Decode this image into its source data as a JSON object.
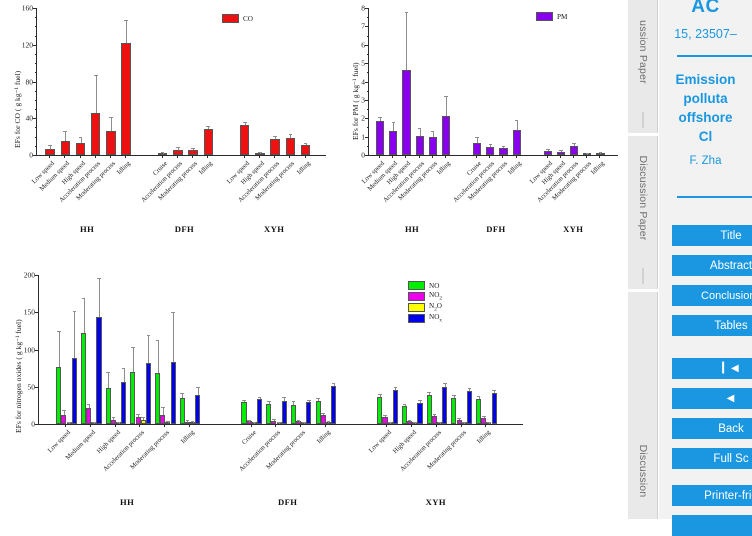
{
  "figure": {
    "charts": [
      {
        "id": "co",
        "title": "",
        "ylabel": "EFs for CO ( g kg⁻¹ fuel)",
        "legend": [
          {
            "name": "CO",
            "color": "#ee1111"
          }
        ],
        "ylim": [
          0,
          160
        ],
        "yticks": [
          0,
          40,
          80,
          120,
          160
        ],
        "groups": [
          {
            "name": "HH",
            "categories": [
              "Low speed",
              "Medium speed",
              "High speed",
              "Acceleration process",
              "Moderating process",
              "Idling"
            ],
            "values": [
              6.5,
              15.5,
              13.0,
              45.5,
              26.5,
              122.0
            ],
            "errors": [
              3.0,
              9.5,
              5.0,
              40.0,
              13.5,
              24.0
            ]
          },
          {
            "name": "DFH",
            "categories": [
              "Cruise",
              "Acceleration process",
              "Moderating process",
              "Idling"
            ],
            "values": [
              1.8,
              6.0,
              5.5,
              28.5
            ],
            "errors": [
              0.8,
              1.5,
              1.5,
              2.2
            ]
          },
          {
            "name": "XYH",
            "categories": [
              "Low speed",
              "High speed",
              "Acceleration process",
              "Moderating process",
              "Idling"
            ],
            "values": [
              32.5,
              1.3,
              17.5,
              19.0,
              10.5
            ],
            "errors": [
              2.5,
              0.6,
              1.8,
              2.5,
              2.0
            ]
          }
        ]
      },
      {
        "id": "pm",
        "title": "",
        "ylabel": "EFs for PM ( g kg⁻¹ fuel)",
        "legend": [
          {
            "name": "PM",
            "color": "#8800ee"
          }
        ],
        "ylim": [
          0,
          8
        ],
        "yticks": [
          0,
          1,
          2,
          3,
          4,
          5,
          6,
          7,
          8
        ],
        "groups": [
          {
            "name": "HH",
            "categories": [
              "Low speed",
              "Medium speed",
              "High speed",
              "Acceleration process",
              "Moderating process",
              "Idling"
            ],
            "values": [
              1.87,
              1.33,
              4.62,
              1.03,
              1.0,
              2.1
            ],
            "errors": [
              0.17,
              0.4,
              3.1,
              0.37,
              0.25,
              1.05
            ]
          },
          {
            "name": "DFH",
            "categories": [
              "Cruise",
              "Acceleration process",
              "Moderating process",
              "Idling"
            ],
            "values": [
              0.67,
              0.45,
              0.4,
              1.37
            ],
            "errors": [
              0.26,
              0.07,
              0.04,
              0.47
            ]
          },
          {
            "name": "XYH",
            "categories": [
              "Low speed",
              "High speed",
              "Acceleration process",
              "Moderating process",
              "Idling"
            ],
            "values": [
              0.22,
              0.17,
              0.5,
              0.04,
              0.1
            ],
            "errors": [
              0.08,
              0.05,
              0.08,
              0.02,
              0.03
            ]
          }
        ]
      },
      {
        "id": "nox",
        "title": "",
        "ylabel": "EFs for nitrogen oxides ( g kg⁻¹ fuel)",
        "legend": [
          {
            "name": "NO",
            "color": "#00ee00"
          },
          {
            "name": "NO2",
            "color": "#ee00ee"
          },
          {
            "name": "N2O",
            "color": "#ffff00"
          },
          {
            "name": "NOx",
            "color": "#0000ee"
          }
        ],
        "ylim": [
          0,
          200
        ],
        "yticks": [
          0,
          50,
          100,
          150,
          200
        ],
        "groups": [
          {
            "name": "HH",
            "categories": [
              "Low speed",
              "Medium speed",
              "High speed",
              "Acceleration process",
              "Moderating process",
              "Idling"
            ],
            "series": {
              "NO": [
                76,
                122,
                48.5,
                70,
                69,
                34.5
              ],
              "NO2": [
                12,
                21,
                6,
                9,
                12,
                2.5
              ],
              "N2O": [
                0.8,
                1.0,
                1.2,
                5.5,
                2.0,
                1.8
              ],
              "NOx": [
                89,
                143,
                57,
                82.5,
                83,
                39.5
              ]
            },
            "errors": {
              "NO": [
                48,
                46,
                20,
                32,
                43,
                6
              ],
              "NO2": [
                5,
                5,
                2,
                3,
                10,
                1
              ],
              "N2O": [
                0.4,
                0.5,
                0.6,
                3,
                1,
                0.8
              ],
              "NOx": [
                61,
                52,
                17,
                36,
                66,
                9
              ]
            }
          },
          {
            "name": "DFH",
            "categories": [
              "Cruise",
              "Acceleration process",
              "Moderating process",
              "Idling"
            ],
            "series": {
              "NO": [
                29,
                27,
                26,
                31
              ],
              "NO2": [
                3.5,
                4.5,
                3.5,
                12
              ],
              "N2O": [
                0.5,
                0.5,
                0.5,
                2.0
              ],
              "NOx": [
                33,
                31,
                29,
                51
              ]
            },
            "errors": {
              "NO": [
                1.5,
                3,
                3,
                2
              ],
              "NO2": [
                0.8,
                1,
                0.8,
                2
              ],
              "N2O": [
                0.2,
                0.2,
                0.2,
                0.5
              ],
              "NOx": [
                1.5,
                3.5,
                2.5,
                2.5
              ]
            }
          },
          {
            "name": "XYH",
            "categories": [
              "Low speed",
              "High speed",
              "Acceleration process",
              "Moderating process",
              "Idling"
            ],
            "series": {
              "NO": [
                36,
                24,
                39,
                35,
                34
              ],
              "NO2": [
                9,
                3.5,
                11,
                6,
                8
              ],
              "N2O": [
                0.6,
                0.4,
                0.8,
                0.6,
                0.6
              ],
              "NOx": [
                45,
                28.5,
                50,
                44,
                41
              ]
            },
            "errors": {
              "NO": [
                3,
                2,
                3,
                2.5,
                2.5
              ],
              "NO2": [
                1.5,
                1,
                1.5,
                1,
                1.5
              ],
              "N2O": [
                0.2,
                0.2,
                0.2,
                0.2,
                0.2
              ],
              "NOx": [
                4,
                2,
                4,
                3,
                3
              ]
            }
          }
        ]
      }
    ]
  },
  "chart_data": [
    {
      "type": "bar",
      "title": "EFs for CO",
      "xlabel": "",
      "ylabel": "EFs for CO ( g kg-1 fuel)",
      "ylim": [
        0,
        160
      ],
      "yticks": [
        0,
        40,
        80,
        120,
        160
      ],
      "grid": false,
      "legend_position": "top-right",
      "legend": [
        "CO"
      ],
      "groups": [
        "HH",
        "DFH",
        "XYH"
      ],
      "categories": [
        "HH / Low speed",
        "HH / Medium speed",
        "HH / High speed",
        "HH / Acceleration process",
        "HH / Moderating process",
        "HH / Idling",
        "DFH / Cruise",
        "DFH / Acceleration process",
        "DFH / Moderating process",
        "DFH / Idling",
        "XYH / Low speed",
        "XYH / High speed",
        "XYH / Acceleration process",
        "XYH / Moderating process",
        "XYH / Idling"
      ],
      "values": [
        6.5,
        15.5,
        13.0,
        45.5,
        26.5,
        122.0,
        1.8,
        6.0,
        5.5,
        28.5,
        32.5,
        1.3,
        17.5,
        19.0,
        10.5
      ],
      "errors": [
        3.0,
        9.5,
        5.0,
        40.0,
        13.5,
        24.0,
        0.8,
        1.5,
        1.5,
        2.2,
        2.5,
        0.6,
        1.8,
        2.5,
        2.0
      ]
    },
    {
      "type": "bar",
      "title": "EFs for PM",
      "xlabel": "",
      "ylabel": "EFs for PM ( g kg-1 fuel)",
      "ylim": [
        0,
        8
      ],
      "yticks": [
        0,
        1,
        2,
        3,
        4,
        5,
        6,
        7,
        8
      ],
      "grid": false,
      "legend_position": "top-right",
      "legend": [
        "PM"
      ],
      "groups": [
        "HH",
        "DFH",
        "XYH"
      ],
      "categories": [
        "HH / Low speed",
        "HH / Medium speed",
        "HH / High speed",
        "HH / Acceleration process",
        "HH / Moderating process",
        "HH / Idling",
        "DFH / Cruise",
        "DFH / Acceleration process",
        "DFH / Moderating process",
        "DFH / Idling",
        "XYH / Low speed",
        "XYH / High speed",
        "XYH / Acceleration process",
        "XYH / Moderating process",
        "XYH / Idling"
      ],
      "values": [
        1.87,
        1.33,
        4.62,
        1.03,
        1.0,
        2.1,
        0.67,
        0.45,
        0.4,
        1.37,
        0.22,
        0.17,
        0.5,
        0.04,
        0.1
      ],
      "errors": [
        0.17,
        0.4,
        3.1,
        0.37,
        0.25,
        1.05,
        0.26,
        0.07,
        0.04,
        0.47,
        0.08,
        0.05,
        0.08,
        0.02,
        0.03
      ]
    },
    {
      "type": "bar",
      "title": "EFs for nitrogen oxides",
      "xlabel": "",
      "ylabel": "EFs for nitrogen oxides ( g kg-1 fuel)",
      "ylim": [
        0,
        200
      ],
      "yticks": [
        0,
        50,
        100,
        150,
        200
      ],
      "grid": false,
      "legend_position": "top-right",
      "groups": [
        "HH",
        "DFH",
        "XYH"
      ],
      "categories": [
        "HH / Low speed",
        "HH / Medium speed",
        "HH / High speed",
        "HH / Acceleration process",
        "HH / Moderating process",
        "HH / Idling",
        "DFH / Cruise",
        "DFH / Acceleration process",
        "DFH / Moderating process",
        "DFH / Idling",
        "XYH / Low speed",
        "XYH / High speed",
        "XYH / Acceleration process",
        "XYH / Moderating process",
        "XYH / Idling"
      ],
      "series": [
        {
          "name": "NO",
          "color": "#00ee00",
          "values": [
            76,
            122,
            48.5,
            70,
            69,
            34.5,
            29,
            27,
            26,
            31,
            36,
            24,
            39,
            35,
            34
          ]
        },
        {
          "name": "NO2",
          "color": "#ee00ee",
          "values": [
            12,
            21,
            6,
            9,
            12,
            2.5,
            3.5,
            4.5,
            3.5,
            12,
            9,
            3.5,
            11,
            6,
            8
          ]
        },
        {
          "name": "N2O",
          "color": "#ffff00",
          "values": [
            0.8,
            1.0,
            1.2,
            5.5,
            2.0,
            1.8,
            0.5,
            0.5,
            0.5,
            2.0,
            0.6,
            0.4,
            0.8,
            0.6,
            0.6
          ]
        },
        {
          "name": "NOx",
          "color": "#0000ee",
          "values": [
            89,
            143,
            57,
            82.5,
            83,
            39.5,
            33,
            31,
            29,
            51,
            45,
            28.5,
            50,
            44,
            41
          ]
        }
      ]
    }
  ],
  "sidebar": {
    "strip_labels": [
      "ussion Paper",
      "Discussion Paper",
      "Discussion"
    ],
    "journal": "AC",
    "issue": "15, 23507–",
    "paper_title_lines": [
      "Emission",
      "polluta",
      "offshore",
      "Cl"
    ],
    "authors": "F. Zha",
    "buttons": [
      {
        "name": "title-page",
        "label": "Title"
      },
      {
        "name": "abstract",
        "label": "Abstract"
      },
      {
        "name": "conclusions",
        "label": "Conclusions"
      },
      {
        "name": "tables",
        "label": "Tables"
      },
      {
        "name": "first-page",
        "label": "▎◀"
      },
      {
        "name": "previous-page",
        "label": "◀"
      },
      {
        "name": "back",
        "label": "Back"
      },
      {
        "name": "full-screen",
        "label": "Full Sc"
      },
      {
        "name": "printer-friendly",
        "label": "Printer-frie"
      }
    ]
  }
}
